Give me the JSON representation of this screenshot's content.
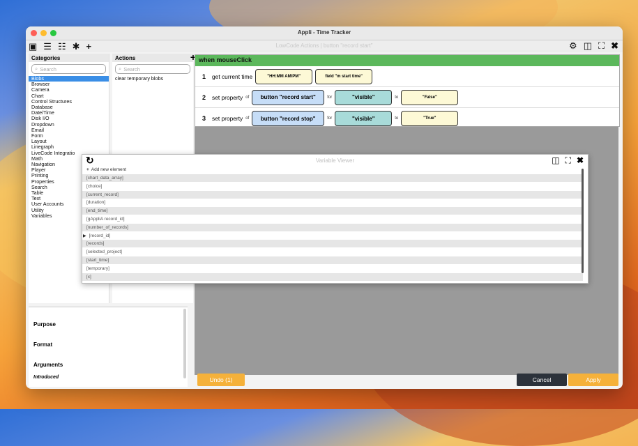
{
  "window": {
    "title": "Appli - Time Tracker"
  },
  "toolbar": {
    "center_text": "LowCode Actions | button \"record start\""
  },
  "categories": {
    "header": "Categories",
    "search_placeholder": "Search",
    "items": [
      "Blobs",
      "Browser",
      "Camera",
      "Chart",
      "Control Structures",
      "Database",
      "Date/Time",
      "Disk I/O",
      "Dropdown",
      "Email",
      "Form",
      "Layout",
      "Linegraph",
      "LiveCode Integratio",
      "Math",
      "Navigation",
      "Player",
      "Printing",
      "Properties",
      "Search",
      "Table",
      "Text",
      "User Accounts",
      "Utility",
      "Variables"
    ]
  },
  "actions": {
    "header": "Actions",
    "search_placeholder": "Search",
    "items": [
      "clear temporary blobs"
    ]
  },
  "rule": {
    "event": "when mouseClick",
    "row1": {
      "num": "1",
      "label": "get current time",
      "b1": "\"HH:MM AM/PM\"",
      "b2": "field \"m start time\""
    },
    "row2": {
      "num": "2",
      "label": "set property",
      "of": "of",
      "target": "button \"record start\"",
      "for": "for",
      "prop": "\"visible\"",
      "to": "to",
      "value": "\"False\""
    },
    "row3": {
      "num": "3",
      "label": "set property",
      "of": "of",
      "target": "button \"record stop\"",
      "for": "for",
      "prop": "\"visible\"",
      "to": "to",
      "value": "\"True\""
    }
  },
  "variable_viewer": {
    "title": "Variable Viewer",
    "add_label": "Add new element",
    "items": [
      "[chart_data_array]",
      "[choice]",
      "[current_record]",
      "[duration]",
      "[end_time]",
      "[gAppliA record_id]",
      "[number_of_records]",
      "[record_id]",
      "[records]",
      "[selected_project]",
      "[start_time]",
      "[temporary]",
      "[x]"
    ]
  },
  "info": {
    "purpose": "Purpose",
    "format": "Format",
    "arguments": "Arguments",
    "introduced": "Introduced"
  },
  "buttons": {
    "undo": "Undo (1)",
    "cancel": "Cancel",
    "apply": "Apply"
  },
  "colors": {
    "event_green": "#5cb85c",
    "target_blue": "#c6ddf7",
    "prop_teal": "#a8dbd9",
    "value_yellow": "#fdf9d6",
    "apply_orange": "#f5b13a",
    "selected_blue": "#3a8ee6"
  }
}
